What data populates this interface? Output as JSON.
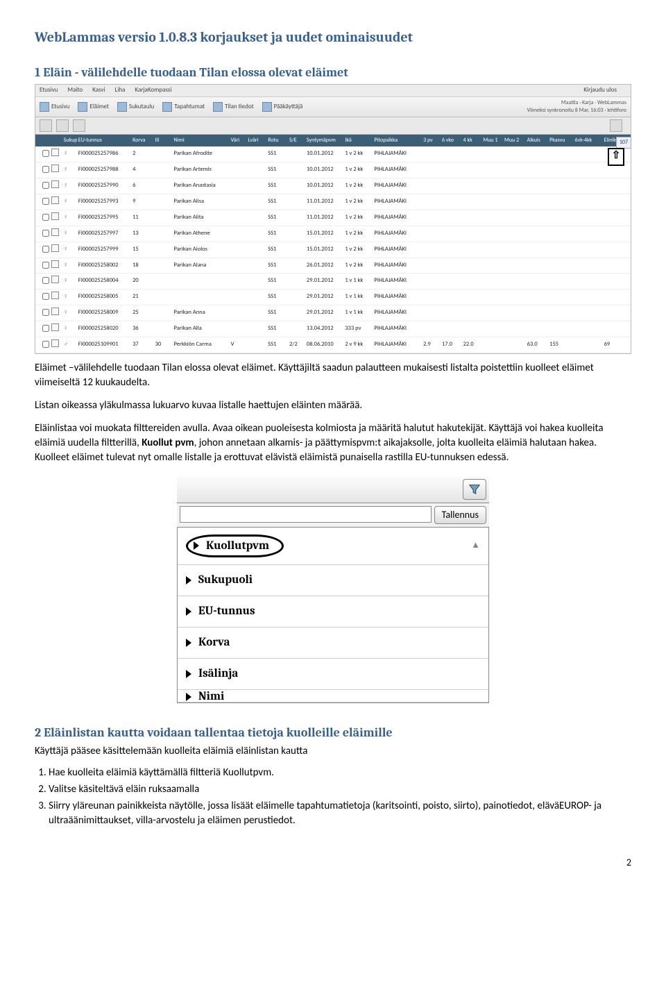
{
  "doc_title": "WebLammas versio 1.0.8.3 korjaukset ja uudet ominaisuudet",
  "section1_title": "1 Eläin - välilehdelle tuodaan Tilan elossa olevat eläimet",
  "app": {
    "topnav": {
      "etusivu": "Etusivu",
      "maito": "Maito",
      "kasvi": "Kasvi",
      "liha": "Liha",
      "kk": "KarjaKompassi",
      "logout": "Kirjaudu ulos"
    },
    "toolbar": {
      "etusivu": "Etusivu",
      "elaimet": "Eläimet",
      "sukutaulu": "Sukutaulu",
      "tapahtumat": "Tapahtumat",
      "tilan": "Tilan tiedot",
      "paak": "Pääkäyttäjä"
    },
    "meta": {
      "line1": "Maatila · Karja · WebLammas",
      "line2": "Viimeksi synkronoitu 8 Mar, 16:03",
      "lehti": "lehtiforo"
    },
    "count": "107",
    "cols": [
      "Sukupuoli",
      "EU-tunnus",
      "Korva",
      "Ill",
      "Nimi",
      "Väri",
      "Lväri",
      "Rotu",
      "S/E",
      "Syntymäpvm",
      "Ikä",
      "Pitopaikka",
      "3 pv",
      "6 vko",
      "4 kk",
      "Muu 1",
      "Muu 2",
      "Alkuis",
      "Pkasvu",
      "6vk-4kk",
      "Elinik."
    ],
    "rows": [
      {
        "sex": "♀",
        "eu": "FI000025257986",
        "korva": "2",
        "ill": "",
        "nimi": "Parikan Afrodite",
        "rotu": "SS1",
        "synt": "10.01.2012",
        "ika": "1 v 2 kk",
        "pito": "PIHLAJAMÄKI"
      },
      {
        "sex": "♀",
        "eu": "FI000025257988",
        "korva": "4",
        "ill": "",
        "nimi": "Parikan Artemis",
        "rotu": "SS1",
        "synt": "10.01.2012",
        "ika": "1 v 2 kk",
        "pito": "PIHLAJAMÄKI"
      },
      {
        "sex": "♀",
        "eu": "FI000025257990",
        "korva": "6",
        "ill": "",
        "nimi": "Parikan Anastasia",
        "rotu": "SS1",
        "synt": "10.01.2012",
        "ika": "1 v 2 kk",
        "pito": "PIHLAJAMÄKI"
      },
      {
        "sex": "♀",
        "eu": "FI000025257993",
        "korva": "9",
        "ill": "",
        "nimi": "Parikan Alisa",
        "rotu": "SS1",
        "synt": "11.01.2012",
        "ika": "1 v 2 kk",
        "pito": "PIHLAJAMÄKI"
      },
      {
        "sex": "♀",
        "eu": "FI000025257995",
        "korva": "11",
        "ill": "",
        "nimi": "Parikan Alita",
        "rotu": "SS1",
        "synt": "11.01.2012",
        "ika": "1 v 2 kk",
        "pito": "PIHLAJAMÄKI"
      },
      {
        "sex": "♀",
        "eu": "FI000025257997",
        "korva": "13",
        "ill": "",
        "nimi": "Parikan Athene",
        "rotu": "SS1",
        "synt": "15.01.2012",
        "ika": "1 v 2 kk",
        "pito": "PIHLAJAMÄKI"
      },
      {
        "sex": "♀",
        "eu": "FI000025257999",
        "korva": "15",
        "ill": "",
        "nimi": "Parikan Aiolos",
        "rotu": "SS1",
        "synt": "15.01.2012",
        "ika": "1 v 2 kk",
        "pito": "PIHLAJAMÄKI"
      },
      {
        "sex": "♀",
        "eu": "FI000025258002",
        "korva": "18",
        "ill": "",
        "nimi": "Parikan Alana",
        "rotu": "SS1",
        "synt": "26.01.2012",
        "ika": "1 v 2 kk",
        "pito": "PIHLAJAMÄKI"
      },
      {
        "sex": "♀",
        "eu": "FI000025258004",
        "korva": "20",
        "ill": "",
        "nimi": "",
        "rotu": "SS1",
        "synt": "29.01.2012",
        "ika": "1 v 1 kk",
        "pito": "PIHLAJAMÄKI"
      },
      {
        "sex": "♀",
        "eu": "FI000025258005",
        "korva": "21",
        "ill": "",
        "nimi": "",
        "rotu": "SS1",
        "synt": "29.01.2012",
        "ika": "1 v 1 kk",
        "pito": "PIHLAJAMÄKI"
      },
      {
        "sex": "♀",
        "eu": "FI000025258009",
        "korva": "25",
        "ill": "",
        "nimi": "Parikan Anna",
        "rotu": "SS1",
        "synt": "29.01.2012",
        "ika": "1 v 1 kk",
        "pito": "PIHLAJAMÄKI"
      },
      {
        "sex": "♀",
        "eu": "FI000025258020",
        "korva": "36",
        "ill": "",
        "nimi": "Parikan Alla",
        "rotu": "SS1",
        "synt": "13.04.2012",
        "ika": "333 pv",
        "pito": "PIHLAJAMÄKI"
      },
      {
        "sex": "♂",
        "eu": "FI000025109901",
        "korva": "37",
        "ill": "30",
        "nimi": "Perkkiön Carma",
        "vari": "V",
        "rotu": "SS1",
        "se": "2/2",
        "synt": "08.06.2010",
        "ika": "2 v 9 kk",
        "pito": "PIHLAJAMÄKI",
        "c3": "2.9",
        "c6": "17.0",
        "c4": "22.0",
        "alk": "63.0",
        "pk": "155",
        "e": "69"
      }
    ]
  },
  "para1": "Eläimet –välilehdelle tuodaan Tilan elossa olevat eläimet. Käyttäjiltä saadun palautteen mukaisesti listalta poistettiin kuolleet eläimet viimeiseltä 12 kuukaudelta.",
  "para2": "Listan oikeassa yläkulmassa lukuarvo kuvaa listalle haettujen eläinten määrää.",
  "para3_a": "Eläinlistaa voi muokata filttereiden avulla. Avaa oikean puoleisesta kolmiosta ja määritä halutut hakutekijät. Käyttäjä voi hakea kuolleita eläimiä uudella filtterillä, ",
  "para3_bold": "Kuollut pvm",
  "para3_b": ", johon annetaan alkamis- ja päättymispvm:t aikajaksolle, jolta kuolleita eläimiä halutaan hakea. Kuolleet eläimet tulevat nyt omalle listalle ja erottuvat elävistä eläimistä punaisella rastilla EU-tunnuksen edessä.",
  "filter": {
    "save": "Tallennus",
    "items": [
      "Kuollutpvm",
      "Sukupuoli",
      "EU-tunnus",
      "Korva",
      "Isälinja",
      "Nimi"
    ]
  },
  "section2_title": "2 Eläinlistan kautta voidaan tallentaa tietoja kuolleille eläimille",
  "section2_sub": "Käyttäjä pääsee käsittelemään kuolleita eläimiä eläinlistan kautta",
  "steps": [
    "Hae kuolleita eläimiä käyttämällä filtteriä Kuollutpvm.",
    "Valitse käsiteltävä eläin ruksaamalla",
    "Siirry yläreunan painikkeista näytölle, jossa lisäät eläimelle tapahtumatietoja (karitsointi, poisto, siirto), painotiedot, eläväEUROP- ja ultraäänimittaukset, villa-arvostelu ja eläimen perustiedot."
  ],
  "page": "2"
}
